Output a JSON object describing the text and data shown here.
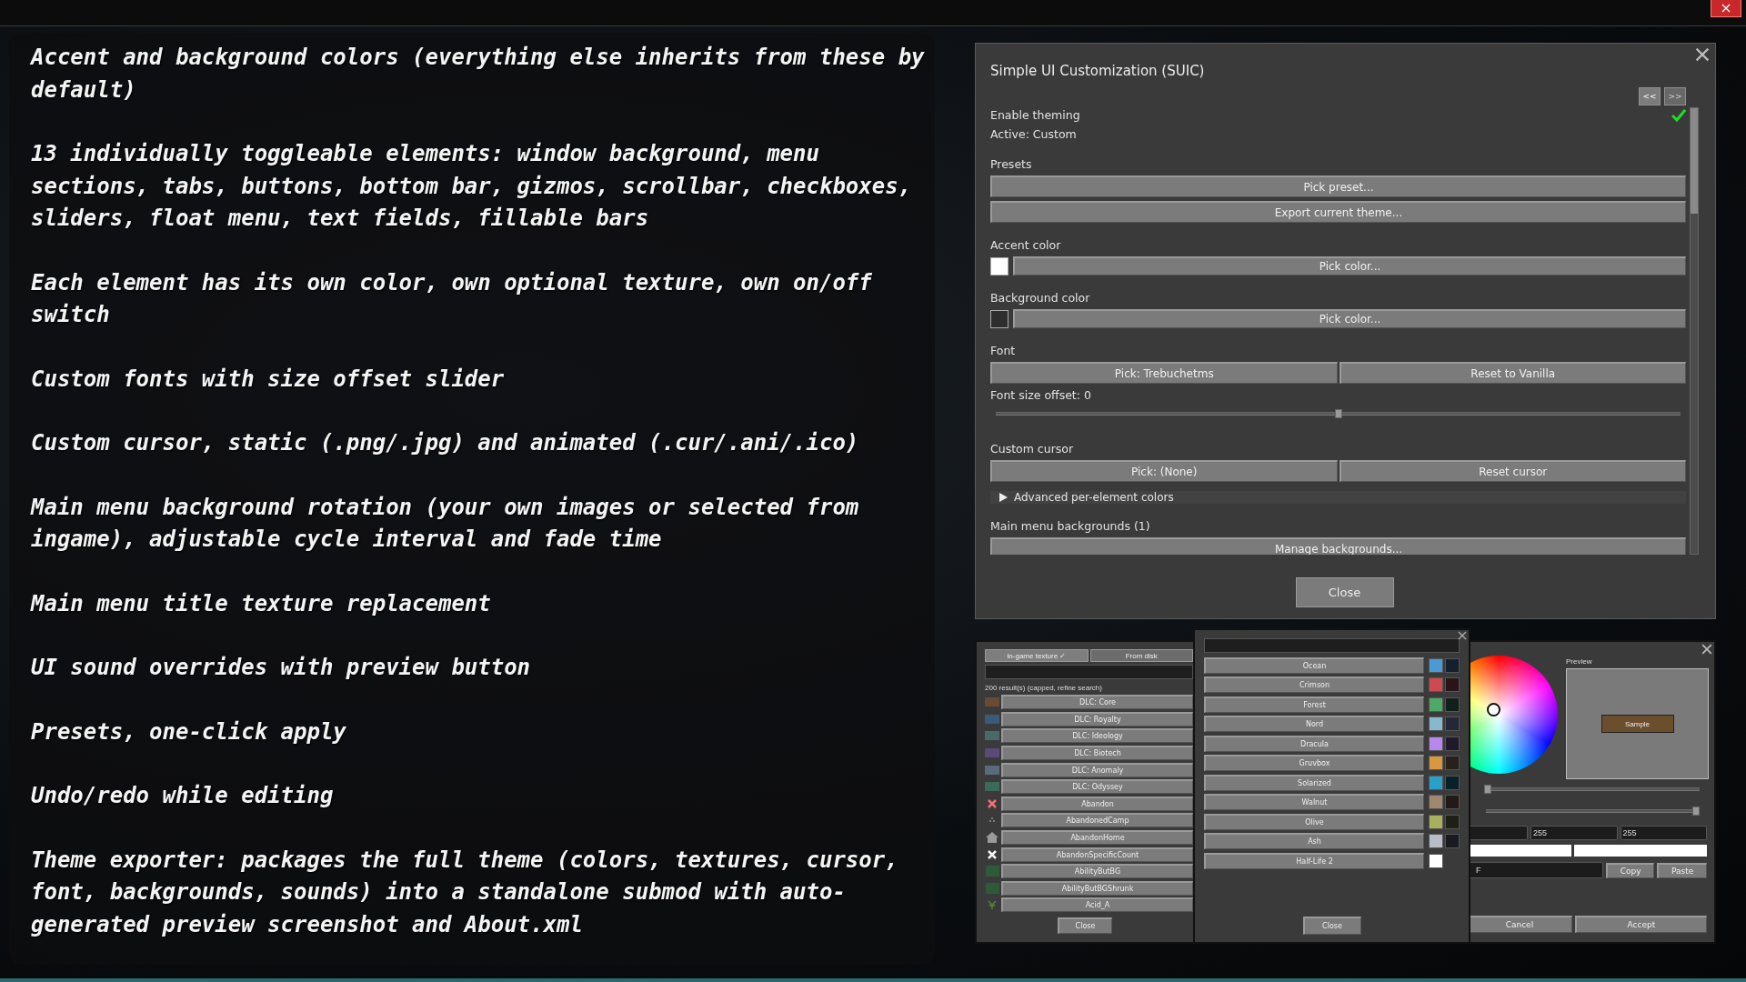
{
  "features": [
    "Accent and background colors (everything else inherits from these by default)",
    "13 individually toggleable elements: window background, menu sections, tabs, buttons, bottom bar, gizmos, scrollbar, checkboxes, sliders, float menu, text fields, fillable bars",
    "Each element has its own color, own optional texture, own on/off switch",
    "Custom fonts with size offset slider",
    "Custom cursor, static (.png/.jpg) and animated (.cur/.ani/.ico)",
    "Main menu background rotation (your own images or selected from ingame), adjustable cycle interval and fade time",
    "Main menu title texture replacement",
    "UI sound overrides with preview button",
    "Presets, one-click apply",
    "Undo/redo while editing",
    "Theme exporter: packages the full theme (colors, textures, cursor, font, backgrounds, sounds) into a standalone submod with auto-generated preview screenshot and About.xml"
  ],
  "suic_window": {
    "title": "Simple UI Customization (SUIC)",
    "nav": [
      {
        "label": "<<",
        "disabled": false
      },
      {
        "label": ">>",
        "disabled": true
      }
    ],
    "rows": [
      {
        "kind": "toggle",
        "label": "Enable theming",
        "checked": true
      },
      {
        "kind": "label",
        "label": "Active: Custom"
      },
      {
        "kind": "heading",
        "label": "Presets"
      },
      {
        "kind": "button",
        "label": "Pick preset..."
      },
      {
        "kind": "button",
        "label": "Export current theme..."
      },
      {
        "kind": "heading",
        "label": "Accent color"
      },
      {
        "kind": "color",
        "color": "#ffffff",
        "label": "Pick color..."
      },
      {
        "kind": "heading",
        "label": "Background color"
      },
      {
        "kind": "color",
        "color": "#2e2e2e",
        "label": "Pick color..."
      },
      {
        "kind": "heading",
        "label": "Font"
      },
      {
        "kind": "pair",
        "labels": [
          "Pick: Trebuchetms",
          "Reset to Vanilla"
        ]
      },
      {
        "kind": "label",
        "label": "Font size offset: 0"
      },
      {
        "kind": "slider",
        "level": 0.5
      },
      {
        "kind": "heading",
        "label": "Custom cursor"
      },
      {
        "kind": "pair",
        "labels": [
          "Pick: (None)",
          "Reset cursor"
        ]
      },
      {
        "kind": "expander",
        "label": "Advanced per-element colors",
        "expanded": false
      },
      {
        "kind": "heading",
        "label": "Main menu backgrounds (1)"
      },
      {
        "kind": "button",
        "label": "Manage backgrounds..."
      }
    ],
    "close": "Close"
  },
  "texture_window": {
    "tabs": [
      {
        "label": "In-game texture ✓",
        "selected": true
      },
      {
        "label": "From disk",
        "selected": false
      }
    ],
    "results": "200 result(s) (capped, refine search)",
    "items": [
      {
        "label": "DLC: Core",
        "kind": "image",
        "color": "#6a4a32"
      },
      {
        "label": "DLC: Royalty",
        "kind": "image",
        "color": "#3b5a7a"
      },
      {
        "label": "DLC: Ideology",
        "kind": "image",
        "color": "#4a6a6a"
      },
      {
        "label": "DLC: Biotech",
        "kind": "image",
        "color": "#5a4a7a"
      },
      {
        "label": "DLC: Anomaly",
        "kind": "image",
        "color": "#5a6a7a"
      },
      {
        "label": "DLC: Odyssey",
        "kind": "image",
        "color": "#3a6a5a"
      },
      {
        "label": "Abandon",
        "kind": "cross",
        "color": "#f07070"
      },
      {
        "label": "AbandonedCamp",
        "kind": "dots"
      },
      {
        "label": "AbandonHome",
        "kind": "house"
      },
      {
        "label": "AbandonSpecificCount",
        "kind": "cross",
        "color": "#f4f4f4"
      },
      {
        "label": "AbilityButBG",
        "kind": "tile"
      },
      {
        "label": "AbilityButBGShrunk",
        "kind": "tile"
      },
      {
        "label": "Acid_A",
        "kind": "leaf"
      }
    ],
    "close": "Close"
  },
  "preset_window": {
    "presets": [
      {
        "name": "Ocean",
        "swatches": [
          {
            "color": "#4a9ad4"
          },
          {
            "color": "#14202e"
          }
        ]
      },
      {
        "name": "Crimson",
        "swatches": [
          {
            "color": "#cc4a50"
          },
          {
            "color": "#2a1418"
          }
        ]
      },
      {
        "name": "Forest",
        "swatches": [
          {
            "color": "#4ea868"
          },
          {
            "color": "#12201a"
          }
        ]
      },
      {
        "name": "Nord",
        "swatches": [
          {
            "color": "#88b8cc"
          },
          {
            "color": "#22283a"
          }
        ]
      },
      {
        "name": "Dracula",
        "swatches": [
          {
            "color": "#b888ee"
          },
          {
            "color": "#1e1a2c"
          }
        ]
      },
      {
        "name": "Gruvbox",
        "swatches": [
          {
            "color": "#d89840"
          },
          {
            "color": "#28201a"
          }
        ]
      },
      {
        "name": "Solarized",
        "swatches": [
          {
            "color": "#28a0c8"
          },
          {
            "color": "#082028"
          }
        ]
      },
      {
        "name": "Walnut",
        "swatches": [
          {
            "color": "#a08870"
          },
          {
            "color": "#221a16"
          }
        ]
      },
      {
        "name": "Olive",
        "swatches": [
          {
            "color": "#a8b060"
          },
          {
            "color": "#1e2018"
          }
        ]
      },
      {
        "name": "Ash",
        "swatches": [
          {
            "color": "#b8bec8"
          },
          {
            "color": "#181c20"
          }
        ]
      },
      {
        "name": "Half-Life 2",
        "swatches": [
          {
            "color": "#ffffff"
          }
        ]
      }
    ],
    "close": "Close"
  },
  "color_picker": {
    "preview_label": "Preview",
    "sample": "Sample",
    "sliders": [
      {
        "level": 0
      },
      {
        "level": 1
      }
    ],
    "fields": [
      "255",
      "255"
    ],
    "swatches": [
      {
        "color": "#ffffff"
      },
      {
        "color": "#ffffff"
      }
    ],
    "hex": "F",
    "copy": "Copy",
    "paste": "Paste",
    "cancel": "Cancel",
    "accept": "Accept"
  }
}
